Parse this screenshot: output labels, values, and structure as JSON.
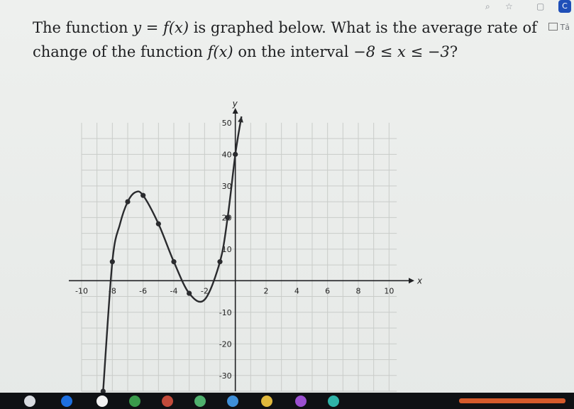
{
  "browser": {
    "badge": "C",
    "bookmark_label": "Tả"
  },
  "question": {
    "line1_a": "The function ",
    "line1_math1": "y = f(x)",
    "line1_b": " is graphed below. What is the average rate of",
    "line2_a": "change of the function ",
    "line2_math": "f(x)",
    "line2_b": " on the interval ",
    "line2_math2": "−8 ≤ x ≤ −3",
    "line2_end": "?"
  },
  "chart_data": {
    "type": "line",
    "xlabel": "x",
    "ylabel": "y",
    "xlim": [
      -10,
      11
    ],
    "ylim": [
      -35,
      52
    ],
    "x_ticks": [
      {
        "value": -10,
        "label": "-10"
      },
      {
        "value": -8,
        "label": "-8"
      },
      {
        "value": -6,
        "label": "-6"
      },
      {
        "value": -4,
        "label": "-4"
      },
      {
        "value": -2,
        "label": "-2"
      },
      {
        "value": 2,
        "label": "2"
      },
      {
        "value": 4,
        "label": "4"
      },
      {
        "value": 6,
        "label": "6"
      },
      {
        "value": 8,
        "label": "8"
      },
      {
        "value": 10,
        "label": "10"
      }
    ],
    "y_ticks": [
      {
        "value": 50,
        "label": "50"
      },
      {
        "value": 40,
        "label": "40"
      },
      {
        "value": 30,
        "label": "30"
      },
      {
        "value": 20,
        "label": "20"
      },
      {
        "value": 10,
        "label": "10"
      },
      {
        "value": -10,
        "label": "-10"
      },
      {
        "value": -20,
        "label": "-20"
      },
      {
        "value": -30,
        "label": "-30"
      }
    ],
    "grid": true,
    "series": [
      {
        "values": [
          {
            "x": -8.6,
            "y": -35
          },
          {
            "x": -8,
            "y": 6
          },
          {
            "x": -7.5,
            "y": 18
          },
          {
            "x": -7,
            "y": 25
          },
          {
            "x": -6.5,
            "y": 28
          },
          {
            "x": -6,
            "y": 27
          },
          {
            "x": -5,
            "y": 18
          },
          {
            "x": -4,
            "y": 6
          },
          {
            "x": -3,
            "y": -4
          },
          {
            "x": -2,
            "y": -6
          },
          {
            "x": -1,
            "y": 6
          },
          {
            "x": -0.5,
            "y": 20
          },
          {
            "x": 0,
            "y": 40
          },
          {
            "x": 0.4,
            "y": 52
          }
        ]
      }
    ],
    "points": [
      {
        "x": -8.6,
        "y": -35
      },
      {
        "x": -8,
        "y": 6
      },
      {
        "x": -7,
        "y": 25
      },
      {
        "x": -6,
        "y": 27
      },
      {
        "x": -5,
        "y": 18
      },
      {
        "x": -4,
        "y": 6
      },
      {
        "x": -3,
        "y": -4
      },
      {
        "x": -1,
        "y": 6
      },
      {
        "x": -0.5,
        "y": 20
      },
      {
        "x": 0,
        "y": 40
      }
    ],
    "colors": {
      "curve": "#2a2b2e",
      "grid": "#c9ccc9",
      "axis": "#1f2023"
    }
  }
}
